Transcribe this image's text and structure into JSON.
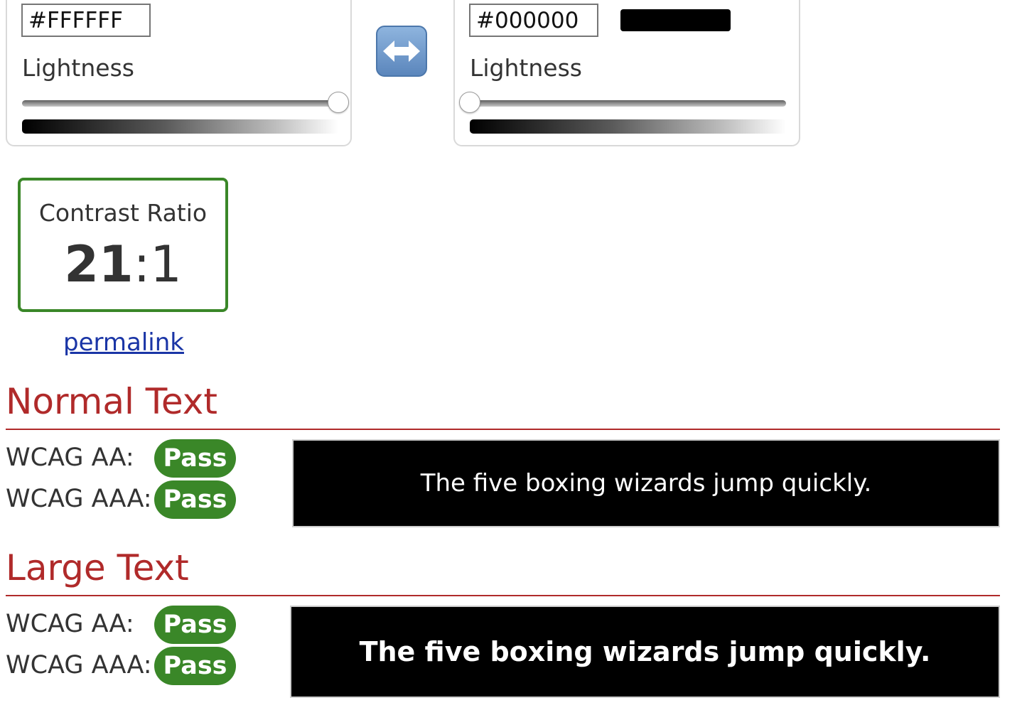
{
  "foreground": {
    "hex": "#FFFFFF",
    "lightness_label": "Lightness",
    "lightness_value": 1.0
  },
  "background": {
    "hex": "#000000",
    "swatch_color": "#000000",
    "lightness_label": "Lightness",
    "lightness_value": 0.0
  },
  "swap_icon": "left-right-arrow-icon",
  "contrast": {
    "title": "Contrast Ratio",
    "numerator": "21",
    "separator": ":",
    "denominator": "1"
  },
  "permalink": "permalink",
  "normal_text": {
    "heading": "Normal Text",
    "aa_label": "WCAG AA:",
    "aa_result": "Pass",
    "aaa_label": "WCAG AAA:",
    "aaa_result": "Pass",
    "sample": "The five boxing wizards jump quickly."
  },
  "large_text": {
    "heading": "Large Text",
    "aa_label": "WCAG AA:",
    "aa_result": "Pass",
    "aaa_label": "WCAG AAA:",
    "aaa_result": "Pass",
    "sample": "The five boxing wizards jump quickly."
  },
  "colors": {
    "pass": "#3a8728",
    "heading": "#b02a2a",
    "link": "#1a35a6",
    "sample_bg": "#000000",
    "sample_fg": "#FFFFFF"
  }
}
